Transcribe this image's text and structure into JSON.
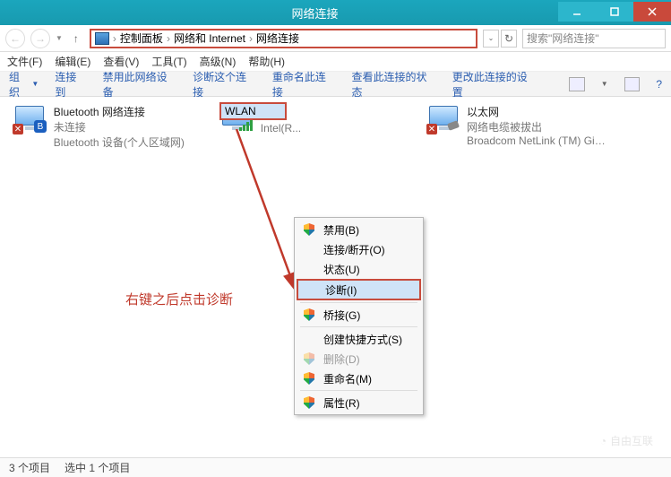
{
  "window": {
    "title": "网络连接"
  },
  "breadcrumb": {
    "p1": "控制面板",
    "p2": "网络和 Internet",
    "p3": "网络连接"
  },
  "search": {
    "placeholder": "搜索\"网络连接\""
  },
  "menu": {
    "file": "文件(F)",
    "edit": "编辑(E)",
    "view": "查看(V)",
    "tools": "工具(T)",
    "advanced": "高级(N)",
    "help": "帮助(H)"
  },
  "toolbar": {
    "organize": "组织",
    "connect": "连接到",
    "disable": "禁用此网络设备",
    "diagnose": "诊断这个连接",
    "rename": "重命名此连接",
    "status": "查看此连接的状态",
    "change": "更改此连接的设置"
  },
  "adapters": {
    "bluetooth": {
      "name": "Bluetooth 网络连接",
      "status": "未连接",
      "device": "Bluetooth 设备(个人区域网)"
    },
    "wlan": {
      "name": "WLAN",
      "device": "Intel(R..."
    },
    "ethernet": {
      "name": "以太网",
      "status": "网络电缆被拔出",
      "device": "Broadcom NetLink (TM) Giga..."
    }
  },
  "context_menu": {
    "disable": "禁用(B)",
    "disconnect": "连接/断开(O)",
    "status": "状态(U)",
    "diagnose": "诊断(I)",
    "bridge": "桥接(G)",
    "shortcut": "创建快捷方式(S)",
    "delete": "删除(D)",
    "rename": "重命名(M)",
    "properties": "属性(R)"
  },
  "annotation": "右键之后点击诊断",
  "statusbar": {
    "count": "3 个项目",
    "selected": "选中 1 个项目"
  },
  "watermark": "自由互联"
}
